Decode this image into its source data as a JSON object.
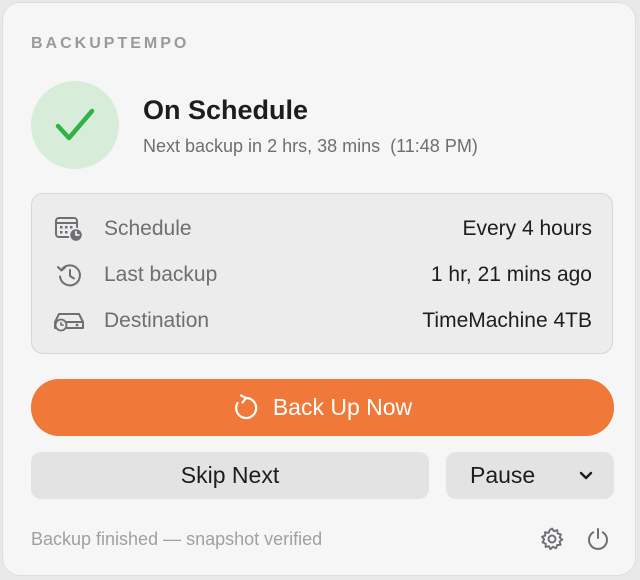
{
  "app": {
    "brand": "BACKUPTEMPO"
  },
  "status": {
    "icon": "checkmark-icon",
    "title": "On Schedule",
    "subtitle": "Next backup in 2 hrs, 38 mins  (11:48 PM)",
    "accent": "#2fb344"
  },
  "info": [
    {
      "icon": "calendar-clock-icon",
      "label": "Schedule",
      "value": "Every 4 hours"
    },
    {
      "icon": "history-icon",
      "label": "Last backup",
      "value": "1 hr, 21 mins ago"
    },
    {
      "icon": "drive-icon",
      "label": "Destination",
      "value": "TimeMachine 4TB"
    }
  ],
  "actions": {
    "primary": {
      "label": "Back Up Now",
      "icon": "refresh-icon",
      "color": "#f07838"
    },
    "skip": {
      "label": "Skip Next"
    },
    "pause": {
      "label": "Pause",
      "icon": "chevron-down-icon"
    }
  },
  "footer": {
    "status_text": "Backup finished — snapshot verified",
    "icons": [
      "gear-icon",
      "power-icon"
    ]
  }
}
